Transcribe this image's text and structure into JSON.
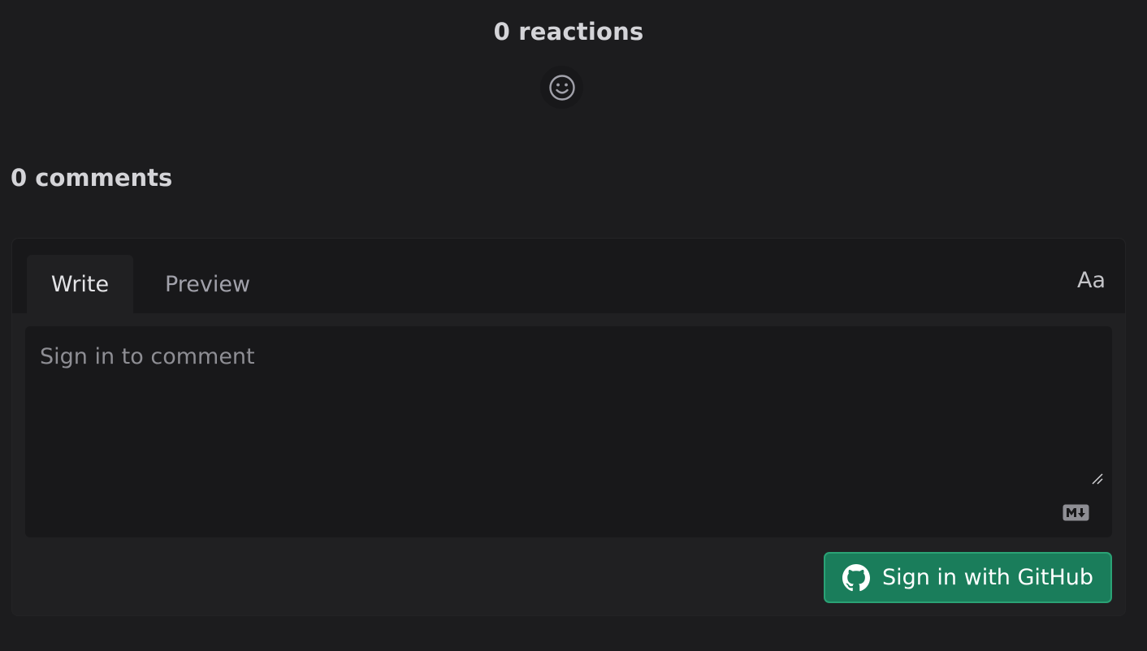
{
  "reactions": {
    "title": "0 reactions",
    "add_reaction_icon": "smiley-icon"
  },
  "comments": {
    "title": "0 comments"
  },
  "editor": {
    "tabs": [
      {
        "label": "Write",
        "active": true
      },
      {
        "label": "Preview",
        "active": false
      }
    ],
    "format_toggle_label": "Aa",
    "placeholder": "Sign in to comment",
    "markdown_icon": "markdown-icon",
    "resize_icon": "resize-handle-icon"
  },
  "signin": {
    "label": "Sign in with GitHub",
    "icon": "github-icon",
    "color": "#1a7d5b"
  }
}
